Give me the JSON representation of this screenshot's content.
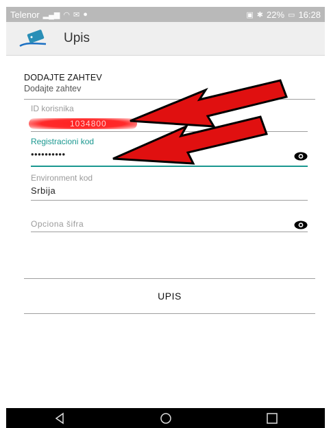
{
  "status_bar": {
    "carrier": "Telenor",
    "battery": "22%",
    "time": "16:28"
  },
  "app_bar": {
    "title": "Upis"
  },
  "form": {
    "section_title": "DODAJTE ZAHTEV",
    "section_subtitle": "Dodajte zahtev",
    "user_id": {
      "label": "ID korisnika",
      "value_visible_part": "1034800"
    },
    "registration_code": {
      "label": "Registracioni kod",
      "masked_value": "••••••••••"
    },
    "environment_code": {
      "label": "Environment kod",
      "value": "Srbija"
    },
    "optional_password": {
      "placeholder": "Opciona šifra"
    }
  },
  "login_button": {
    "label": "UPIS"
  },
  "colors": {
    "accent": "#19978f",
    "annotation_arrow": "#e01010",
    "redaction": "#ff2020"
  },
  "icons": [
    "signal-icon",
    "wifi-icon",
    "mail-icon",
    "nfc-icon",
    "bluetooth-icon",
    "battery-icon",
    "eye-icon",
    "back-icon",
    "home-icon",
    "recents-icon"
  ]
}
